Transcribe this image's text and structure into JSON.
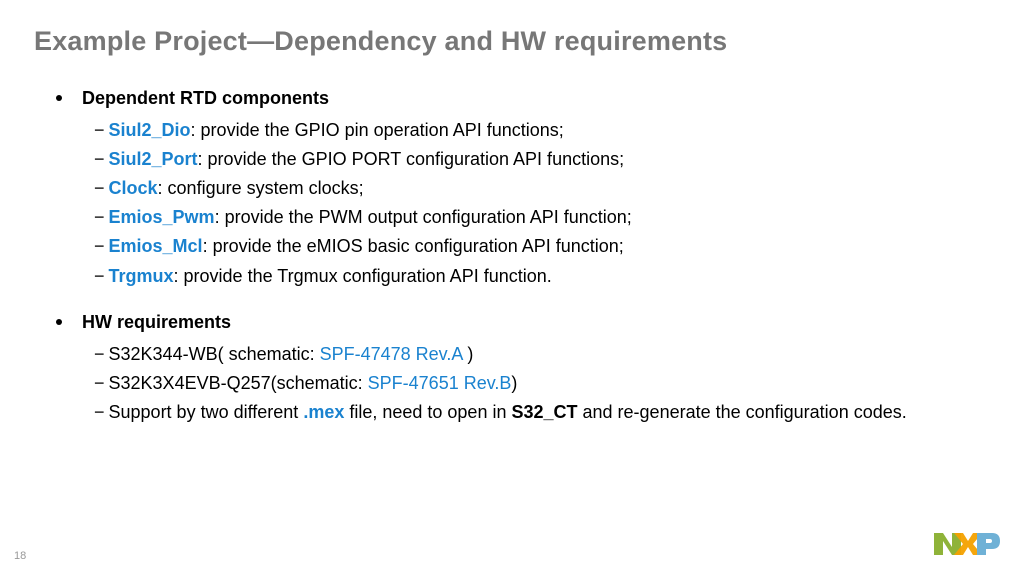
{
  "title": "Example Project—Dependency and HW requirements",
  "section1": {
    "heading": "Dependent RTD components",
    "items": [
      {
        "name": "Siul2_Dio",
        "desc": ": provide the GPIO pin operation API functions;"
      },
      {
        "name": "Siul2_Port",
        "desc": ": provide the GPIO PORT configuration API functions;"
      },
      {
        "name": "Clock",
        "desc": ": configure system clocks;"
      },
      {
        "name": "Emios_Pwm",
        "desc": ": provide the PWM output configuration API function;"
      },
      {
        "name": "Emios_Mcl",
        "desc": ": provide the eMIOS basic configuration API function;"
      },
      {
        "name": "Trgmux",
        "desc": ": provide the Trgmux configuration API function."
      }
    ]
  },
  "section2": {
    "heading": "HW requirements",
    "hw1_pre": "S32K344-WB( schematic: ",
    "hw1_link": "SPF-47478 Rev.A",
    "hw1_post": " )",
    "hw2_pre": "S32K3X4EVB-Q257(schematic: ",
    "hw2_link": "SPF-47651 Rev.B",
    "hw2_post": ")",
    "hw3_pre": "Support by two different ",
    "hw3_mex": ".mex",
    "hw3_mid": " file, need to open in ",
    "hw3_ct": "S32_CT",
    "hw3_post": " and re-generate the configuration codes."
  },
  "page_number": "18",
  "dash": "−"
}
